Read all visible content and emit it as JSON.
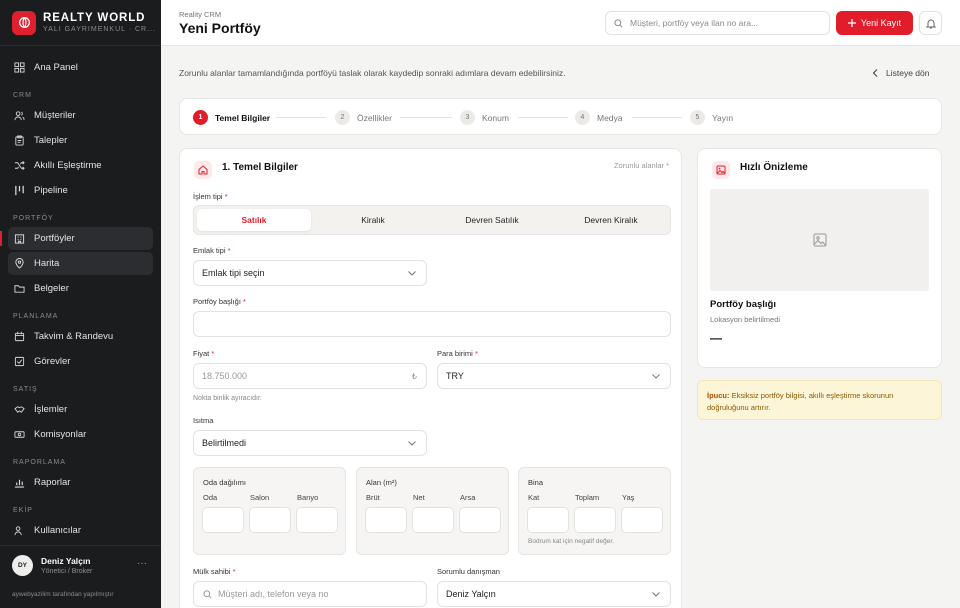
{
  "brand": {
    "name": "REALTY WORLD",
    "sub": "YALI GAYRIMENKUL · CR..."
  },
  "nav": {
    "main": [
      {
        "label": "Ana Panel",
        "icon": "dashboard-icon"
      }
    ],
    "sections": [
      {
        "title": "CRM",
        "items": [
          {
            "label": "Müşteriler"
          },
          {
            "label": "Talepler"
          },
          {
            "label": "Akıllı Eşleştirme"
          },
          {
            "label": "Pipeline"
          }
        ]
      },
      {
        "title": "PORTFÖY",
        "items": [
          {
            "label": "Portföyler"
          },
          {
            "label": "Harita"
          },
          {
            "label": "Belgeler"
          }
        ]
      },
      {
        "title": "PLANLAMA",
        "items": [
          {
            "label": "Takvim & Randevu"
          },
          {
            "label": "Görevler"
          }
        ]
      },
      {
        "title": "SATIŞ",
        "items": [
          {
            "label": "İşlemler"
          },
          {
            "label": "Komisyonlar"
          }
        ]
      },
      {
        "title": "RAPORLAMA",
        "items": [
          {
            "label": "Raporlar"
          }
        ]
      },
      {
        "title": "EKİP",
        "items": [
          {
            "label": "Kullanıcılar"
          }
        ]
      }
    ]
  },
  "user": {
    "initials": "DY",
    "name": "Deniz Yalçın",
    "role": "Yönetici / Broker",
    "more": "···"
  },
  "credit": "aywebyazilim tarafından yapılmıştır",
  "header": {
    "crumb": "Reality CRM",
    "title": "Yeni Portföy",
    "search_placeholder": "Müşteri, portföy veya ilan no ara...",
    "new_button": "Yeni Kayıt"
  },
  "info": "Zorunlu alanlar tamamlandığında portföyü taslak olarak kaydedip sonraki adımlara devam edebilirsiniz.",
  "back": "Listeye dön",
  "steps": [
    {
      "num": "1",
      "label": "Temel Bilgiler"
    },
    {
      "num": "2",
      "label": "Özellikler"
    },
    {
      "num": "3",
      "label": "Konum"
    },
    {
      "num": "4",
      "label": "Medya"
    },
    {
      "num": "5",
      "label": "Yayın"
    }
  ],
  "form": {
    "title": "1. Temel Bilgiler",
    "required_note": "Zorunlu alanlar *",
    "islem_label": "İşlem tipi",
    "islem_options": [
      "Satılık",
      "Kiralık",
      "Devren Satılık",
      "Devren Kiralık"
    ],
    "emlak_label": "Emlak tipi",
    "emlak_value": "Emlak tipi seçin",
    "baslik_label": "Portföy başlığı",
    "fiyat_label": "Fiyat",
    "fiyat_placeholder": "18.750.000",
    "currency_symbol": "₺",
    "para_label": "Para birimi",
    "para_value": "TRY",
    "fiyat_help": "Nokta binlik ayıracıdır.",
    "isitma_label": "Isıtma",
    "isitma_value": "Belirtilmedi",
    "groups": [
      {
        "title": "Oda dağılımı",
        "fields": [
          "Oda",
          "Salon",
          "Banyo"
        ],
        "help": ""
      },
      {
        "title": "Alan (m²)",
        "fields": [
          "Brüt",
          "Net",
          "Arsa"
        ],
        "help": ""
      },
      {
        "title": "Bina",
        "fields": [
          "Kat",
          "Toplam",
          "Yaş"
        ],
        "help": "Bodrum kat için negatif değer."
      }
    ],
    "sahip_label": "Mülk sahibi",
    "sahip_placeholder": "Müşteri adı, telefon veya no",
    "danisman_label": "Sorumlu danışman",
    "danisman_value": "Deniz Yalçın"
  },
  "preview": {
    "title": "Hızlı Önizleme",
    "listing_title": "Portföy başlığı",
    "location": "Lokasyon belirtilmedi",
    "price": "—"
  },
  "tip": {
    "label": "İpucu:",
    "text": " Eksiksiz portföy bilgisi, akıllı eşleştirme skorunun doğruluğunu artırır."
  },
  "colors": {
    "accent": "#e21d2b",
    "sidebar": "#1b1c1e"
  }
}
